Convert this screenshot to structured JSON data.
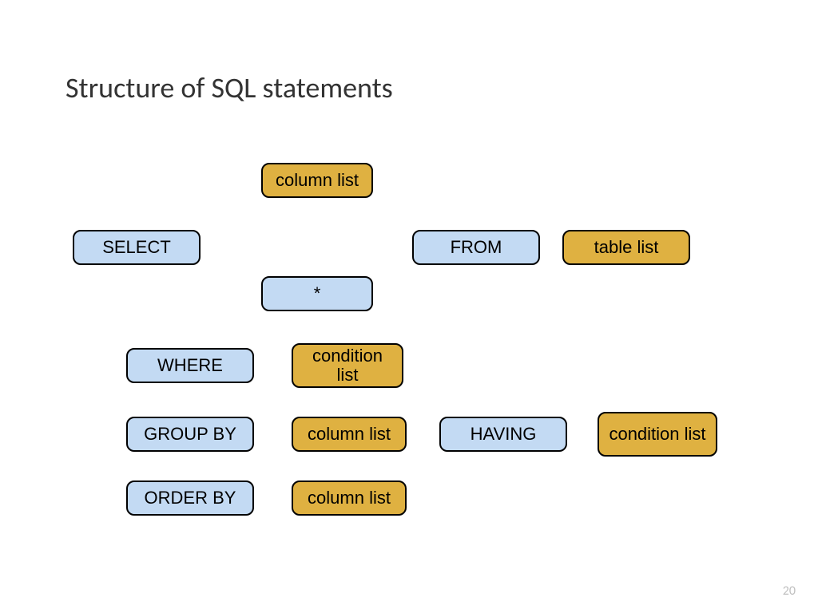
{
  "title": "Structure of SQL statements",
  "page_number": "20",
  "boxes": {
    "column_list_top": "column list",
    "select": "SELECT",
    "from": "FROM",
    "table_list": "table list",
    "star": "*",
    "where": "WHERE",
    "condition_list_where": "condition list",
    "group_by": "GROUP BY",
    "column_list_group": "column list",
    "having": "HAVING",
    "condition_list_having": "condition list",
    "order_by": "ORDER BY",
    "column_list_order": "column list"
  }
}
